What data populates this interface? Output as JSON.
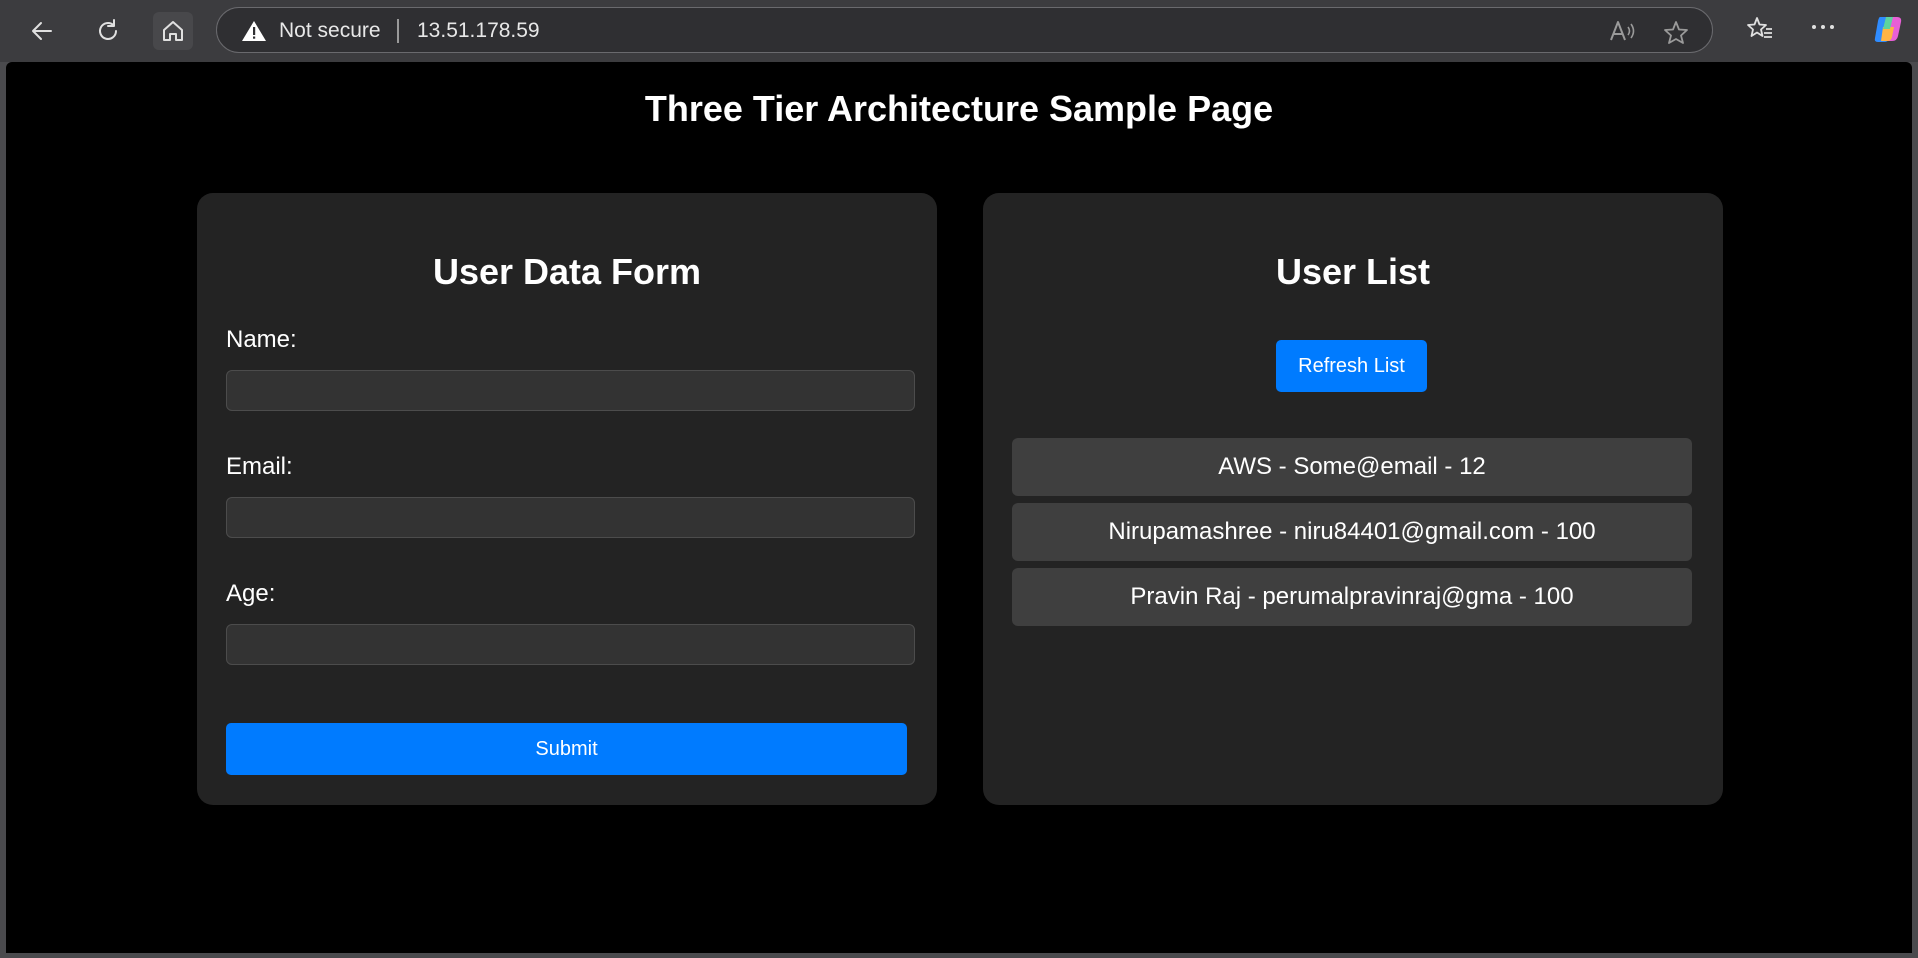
{
  "browser": {
    "security_label": "Not secure",
    "url": "13.51.178.59"
  },
  "page": {
    "title": "Three Tier Architecture Sample Page"
  },
  "form": {
    "title": "User Data Form",
    "name_label": "Name:",
    "name_value": "",
    "email_label": "Email:",
    "email_value": "",
    "age_label": "Age:",
    "age_value": "",
    "submit_label": "Submit"
  },
  "list": {
    "title": "User List",
    "refresh_label": "Refresh List",
    "users": [
      "AWS - Some@email - 12",
      "Nirupamashree - niru84401@gmail.com - 100",
      "Pravin Raj - perumalpravinraj@gma - 100"
    ]
  },
  "colors": {
    "accent": "#007bff",
    "card_bg": "#232323",
    "page_bg": "#000000"
  }
}
